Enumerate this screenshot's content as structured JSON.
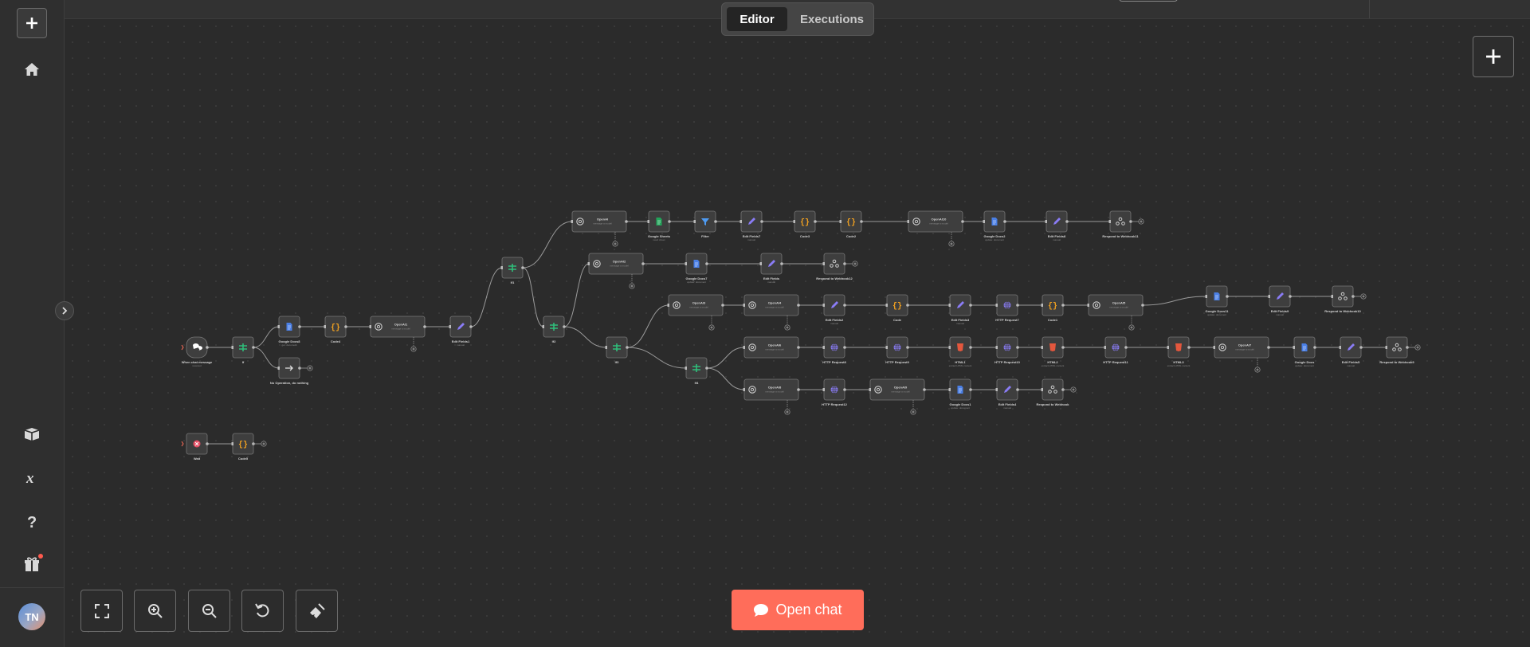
{
  "tabs": {
    "editor": "Editor",
    "executions": "Executions"
  },
  "open_chat_label": "Open chat",
  "user_initials": "TN",
  "sidebar": {
    "icons": [
      "plus-icon",
      "home-icon",
      "templates-icon",
      "variables-icon",
      "help-icon",
      "gift-icon"
    ]
  },
  "colors": {
    "accent": "#ff6d5a",
    "node_bg": "#3e3e3e",
    "node_border": "#777777",
    "edge": "#9a9a9a",
    "canvas": "#2b2b2b",
    "openai": "#cfcfcf",
    "docs": "#4a7fe5",
    "sheets": "#22a55a",
    "filter": "#4e9bf2",
    "code": "#f0a020",
    "pen": "#8a7cf6",
    "http": "#8a7cf6",
    "html": "#e4573d",
    "switch": "#2fbe7a",
    "error": "#e64d64"
  },
  "nodes": [
    {
      "id": "chat",
      "label": "When chat message",
      "sub": "received",
      "type": "chat"
    },
    {
      "id": "sw1",
      "label": "If",
      "sub": "",
      "type": "switch"
    },
    {
      "id": "gdoc8",
      "label": "Google Docs8",
      "sub": "get: document",
      "type": "docs"
    },
    {
      "id": "code4",
      "label": "Code4",
      "sub": "",
      "type": "code"
    },
    {
      "id": "oa1",
      "label": "OpenAI1",
      "sub": "message a model",
      "type": "openai"
    },
    {
      "id": "ef1",
      "label": "Edit Fields1",
      "sub": "manual",
      "type": "pen"
    },
    {
      "id": "noop",
      "label": "No Operation, do nothing",
      "sub": "",
      "type": "noop"
    },
    {
      "id": "if1",
      "label": "If1",
      "sub": "",
      "type": "switch"
    },
    {
      "id": "if2",
      "label": "If2",
      "sub": "",
      "type": "switch"
    },
    {
      "id": "if3",
      "label": "If3",
      "sub": "",
      "type": "switch"
    },
    {
      "id": "if4",
      "label": "If4",
      "sub": "",
      "type": "switch"
    },
    {
      "id": "oa",
      "label": "OpenAI",
      "sub": "message a model",
      "type": "openai"
    },
    {
      "id": "gsheets",
      "label": "Google Sheets",
      "sub": "read: sheet",
      "type": "sheets"
    },
    {
      "id": "filter",
      "label": "Filter",
      "sub": "",
      "type": "filter"
    },
    {
      "id": "ef7",
      "label": "Edit Fields7",
      "sub": "manual",
      "type": "pen"
    },
    {
      "id": "code3",
      "label": "Code3",
      "sub": "",
      "type": "code"
    },
    {
      "id": "code2",
      "label": "Code2",
      "sub": "",
      "type": "code"
    },
    {
      "id": "oa10",
      "label": "OpenAI10",
      "sub": "message a model",
      "type": "openai"
    },
    {
      "id": "gdoc2",
      "label": "Google Docs2",
      "sub": "update: document",
      "type": "docs"
    },
    {
      "id": "ef8",
      "label": "Edit Fields8",
      "sub": "manual",
      "type": "pen"
    },
    {
      "id": "rw11",
      "label": "Respond to Webhook11",
      "sub": "",
      "type": "webhook"
    },
    {
      "id": "oa2",
      "label": "OpenAI2",
      "sub": "message a model",
      "type": "openai"
    },
    {
      "id": "gdoc7",
      "label": "Google Docs7",
      "sub": "update: document",
      "type": "docs"
    },
    {
      "id": "ef",
      "label": "Edit Fields",
      "sub": "manual",
      "type": "pen"
    },
    {
      "id": "rw12",
      "label": "Respond to Webhook12",
      "sub": "",
      "type": "webhook"
    },
    {
      "id": "oa3",
      "label": "OpenAI3",
      "sub": "message a model",
      "type": "openai"
    },
    {
      "id": "oa4",
      "label": "OpenAI4",
      "sub": "message a model",
      "type": "openai"
    },
    {
      "id": "ef2",
      "label": "Edit Fields2",
      "sub": "manual",
      "type": "pen"
    },
    {
      "id": "code",
      "label": "Code",
      "sub": "",
      "type": "code"
    },
    {
      "id": "ef3",
      "label": "Edit Fields3",
      "sub": "manual",
      "type": "pen"
    },
    {
      "id": "http7",
      "label": "HTTP Request7",
      "sub": "",
      "type": "http"
    },
    {
      "id": "code1",
      "label": "Code1",
      "sub": "",
      "type": "code"
    },
    {
      "id": "oa5",
      "label": "OpenAI5",
      "sub": "message a model",
      "type": "openai"
    },
    {
      "id": "gdoc11",
      "label": "Google Docs11",
      "sub": "update: document",
      "type": "docs"
    },
    {
      "id": "ef9",
      "label": "Edit Fields9",
      "sub": "manual",
      "type": "pen"
    },
    {
      "id": "rw10",
      "label": "Respond to Webhook10",
      "sub": "",
      "type": "webhook"
    },
    {
      "id": "oa6",
      "label": "OpenAI6",
      "sub": "message a model",
      "type": "openai"
    },
    {
      "id": "http8",
      "label": "HTTP Request8",
      "sub": "",
      "type": "http"
    },
    {
      "id": "http9",
      "label": "HTTP Request9",
      "sub": "",
      "type": "http"
    },
    {
      "id": "html1",
      "label": "HTML1",
      "sub": "extract HTML content",
      "type": "html"
    },
    {
      "id": "http10",
      "label": "HTTP Request10",
      "sub": "",
      "type": "http"
    },
    {
      "id": "html2",
      "label": "HTML2",
      "sub": "extract HTML content",
      "type": "html"
    },
    {
      "id": "http11",
      "label": "HTTP Request11",
      "sub": "",
      "type": "http"
    },
    {
      "id": "html3",
      "label": "HTML3",
      "sub": "extract HTML content",
      "type": "html"
    },
    {
      "id": "oa7",
      "label": "OpenAI7",
      "sub": "message a model",
      "type": "openai"
    },
    {
      "id": "gdoc",
      "label": "Google Docs",
      "sub": "update: document",
      "type": "docs"
    },
    {
      "id": "ef5",
      "label": "Edit Fields5",
      "sub": "manual",
      "type": "pen"
    },
    {
      "id": "rw9",
      "label": "Respond to Webhook9",
      "sub": "",
      "type": "webhook"
    },
    {
      "id": "oa8",
      "label": "OpenAI8",
      "sub": "message a model",
      "type": "openai"
    },
    {
      "id": "http12",
      "label": "HTTP Request12",
      "sub": "",
      "type": "http"
    },
    {
      "id": "oa9",
      "label": "OpenAI9",
      "sub": "message a model",
      "type": "openai"
    },
    {
      "id": "gdoc1",
      "label": "Google Docs1",
      "sub": "update: document",
      "type": "docs"
    },
    {
      "id": "ef4",
      "label": "Edit Fields4",
      "sub": "manual",
      "type": "pen"
    },
    {
      "id": "rw",
      "label": "Respond to Webhook",
      "sub": "",
      "type": "webhook"
    },
    {
      "id": "wait",
      "label": "Wait",
      "sub": "",
      "type": "error"
    },
    {
      "id": "code5",
      "label": "Code5",
      "sub": "",
      "type": "code"
    }
  ],
  "edges": [
    [
      "chat",
      "sw1"
    ],
    [
      "sw1",
      "gdoc8"
    ],
    [
      "sw1",
      "noop"
    ],
    [
      "gdoc8",
      "code4"
    ],
    [
      "code4",
      "oa1"
    ],
    [
      "oa1",
      "ef1"
    ],
    [
      "ef1",
      "if1"
    ],
    [
      "if1",
      "oa"
    ],
    [
      "if1",
      "if2"
    ],
    [
      "oa",
      "gsheets"
    ],
    [
      "gsheets",
      "filter"
    ],
    [
      "filter",
      "ef7"
    ],
    [
      "ef7",
      "code3"
    ],
    [
      "code3",
      "code2"
    ],
    [
      "code2",
      "oa10"
    ],
    [
      "oa10",
      "gdoc2"
    ],
    [
      "gdoc2",
      "ef8"
    ],
    [
      "ef8",
      "rw11"
    ],
    [
      "if2",
      "oa2"
    ],
    [
      "if2",
      "if3"
    ],
    [
      "oa2",
      "gdoc7"
    ],
    [
      "gdoc7",
      "ef"
    ],
    [
      "ef",
      "rw12"
    ],
    [
      "if3",
      "oa3"
    ],
    [
      "if3",
      "if4"
    ],
    [
      "oa3",
      "oa4"
    ],
    [
      "oa4",
      "ef2"
    ],
    [
      "ef2",
      "code"
    ],
    [
      "code",
      "ef3"
    ],
    [
      "ef3",
      "http7"
    ],
    [
      "http7",
      "code1"
    ],
    [
      "code1",
      "oa5"
    ],
    [
      "oa5",
      "gdoc11"
    ],
    [
      "gdoc11",
      "ef9"
    ],
    [
      "ef9",
      "rw10"
    ],
    [
      "if4",
      "oa6"
    ],
    [
      "if4",
      "oa8"
    ],
    [
      "oa6",
      "http8"
    ],
    [
      "http8",
      "http9"
    ],
    [
      "http9",
      "html1"
    ],
    [
      "html1",
      "http10"
    ],
    [
      "http10",
      "html2"
    ],
    [
      "html2",
      "http11"
    ],
    [
      "http11",
      "html3"
    ],
    [
      "html3",
      "oa7"
    ],
    [
      "oa7",
      "gdoc"
    ],
    [
      "gdoc",
      "ef5"
    ],
    [
      "ef5",
      "rw9"
    ],
    [
      "oa8",
      "http12"
    ],
    [
      "http12",
      "oa9"
    ],
    [
      "oa9",
      "gdoc1"
    ],
    [
      "gdoc1",
      "ef4"
    ],
    [
      "ef4",
      "rw"
    ],
    [
      "wait",
      "code5"
    ]
  ],
  "end_plus": [
    "noop",
    "rw11",
    "rw12",
    "rw10",
    "rw9",
    "rw",
    "code5"
  ],
  "sub_plus": [
    "oa1",
    "oa",
    "oa10",
    "oa2",
    "oa3",
    "oa4",
    "oa5",
    "oa7",
    "oa8",
    "oa9"
  ]
}
